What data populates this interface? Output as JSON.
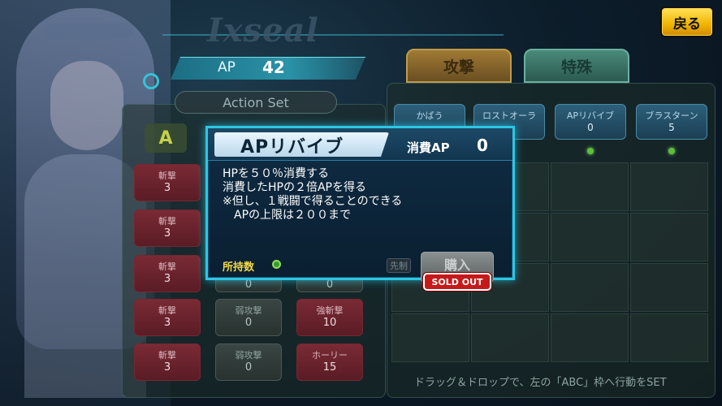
{
  "header": {
    "logo": "Ixseal",
    "ap_label": "AP",
    "ap_value": "42",
    "back_label": "戻る"
  },
  "tabs": [
    {
      "label": "攻撃",
      "active": false
    },
    {
      "label": "特殊",
      "active": true
    }
  ],
  "action_set": {
    "title": "Action Set",
    "slot_label": "A",
    "rows": [
      [
        {
          "name": "斬撃",
          "value": "3"
        },
        {
          "name": "",
          "value": ""
        },
        {
          "name": "",
          "value": ""
        }
      ],
      [
        {
          "name": "斬撃",
          "value": "3"
        },
        {
          "name": "",
          "value": ""
        },
        {
          "name": "",
          "value": ""
        }
      ],
      [
        {
          "name": "斬撃",
          "value": "3"
        },
        {
          "name": "",
          "value": "0"
        },
        {
          "name": "",
          "value": "0"
        }
      ],
      [
        {
          "name": "斬撃",
          "value": "3"
        },
        {
          "name": "弱攻撃",
          "value": "0"
        },
        {
          "name": "強斬撃",
          "value": "10"
        }
      ],
      [
        {
          "name": "斬撃",
          "value": "3"
        },
        {
          "name": "弱攻撃",
          "value": "0"
        },
        {
          "name": "ホーリー",
          "value": "15"
        }
      ]
    ]
  },
  "specials": [
    {
      "name": "かばう",
      "value": ""
    },
    {
      "name": "ロストオーラ",
      "value": ""
    },
    {
      "name": "APリバイブ",
      "value": "0"
    },
    {
      "name": "ブラスターン",
      "value": "5"
    }
  ],
  "hint": "ドラッグ＆ドロップで、左の「ABC」枠へ行動をSET",
  "modal": {
    "title": "APリバイブ",
    "cost_label": "消費AP",
    "cost_value": "0",
    "description": [
      "HPを５０％消費する",
      "消費したHPの２倍APを得る",
      "※但し、１戦闘で得ることのできる",
      "　APの上限は２００まで"
    ],
    "owned_label": "所持数",
    "first_strike_label": "先制",
    "buy_label": "購入",
    "sold_out_label": "SOLD OUT"
  },
  "colors": {
    "accent": "#2ec6e4",
    "back_button": "#f0b400",
    "sold_out": "#c61a1a",
    "owned_label": "#f2d94a"
  }
}
